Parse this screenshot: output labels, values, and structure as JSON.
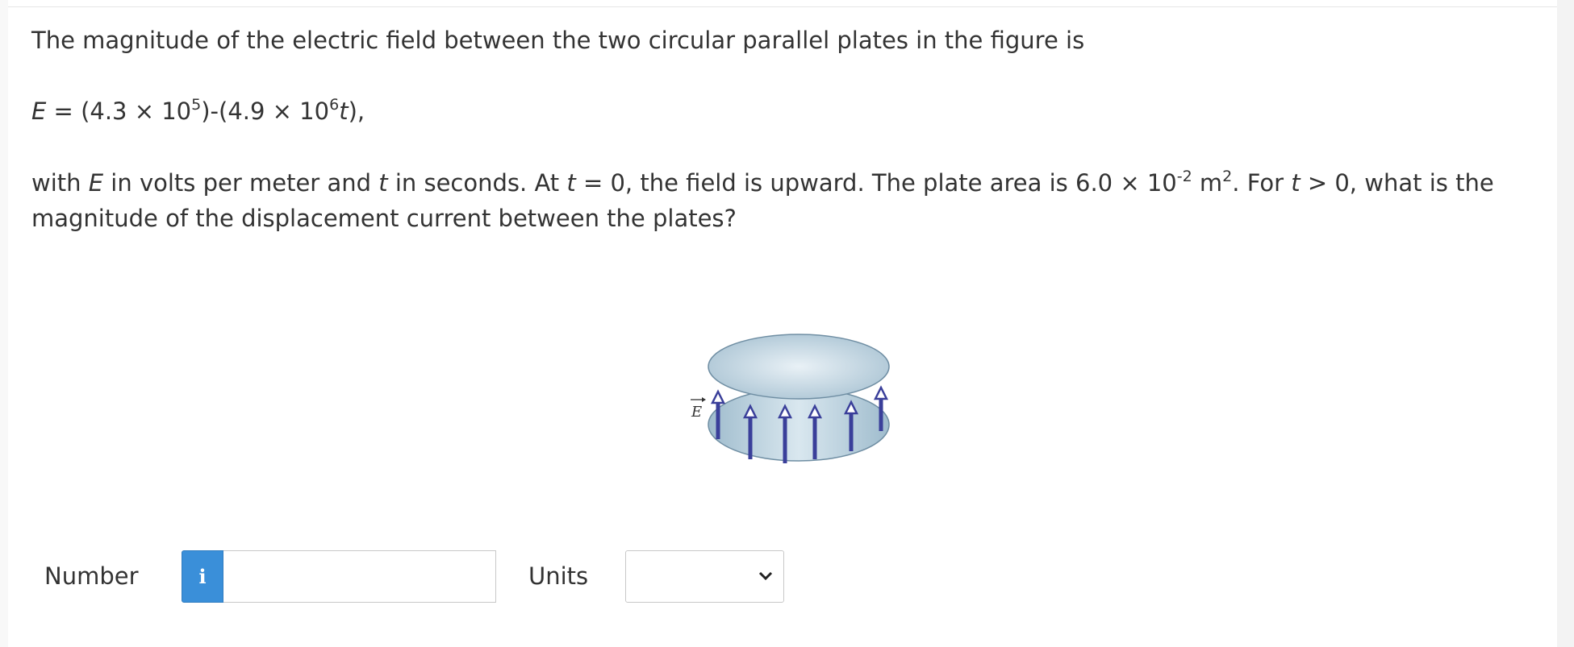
{
  "question": {
    "intro": "The magnitude of the electric field between the two circular parallel plates in the figure is",
    "equation": {
      "var_E": "E",
      "eq_part1": " = (4.3 × 10",
      "exp1": "5",
      "eq_part2": ")-(4.9 × 10",
      "exp2": "6",
      "var_t": "t",
      "eq_part3": "),"
    },
    "body": {
      "s1": "with ",
      "var_E": "E",
      "s2": " in volts per meter and ",
      "var_t1": "t",
      "s3": " in seconds. At ",
      "var_t2": "t",
      "s4": " = 0, the field is upward. The plate area is 6.0 × 10",
      "exp_area": "-2",
      "s5": " m",
      "exp_m": "2",
      "s6": ". For ",
      "var_t3": "t",
      "s7": " > 0, what is the magnitude of the displacement current between the plates?"
    }
  },
  "figure": {
    "field_label": "E",
    "plate_color": "#c5d9e6",
    "arrow_color": "#3a3f9a"
  },
  "answer": {
    "number_label": "Number",
    "info_icon": "info-icon",
    "info_glyph": "i",
    "number_value": "",
    "units_label": "Units",
    "units_value": ""
  }
}
